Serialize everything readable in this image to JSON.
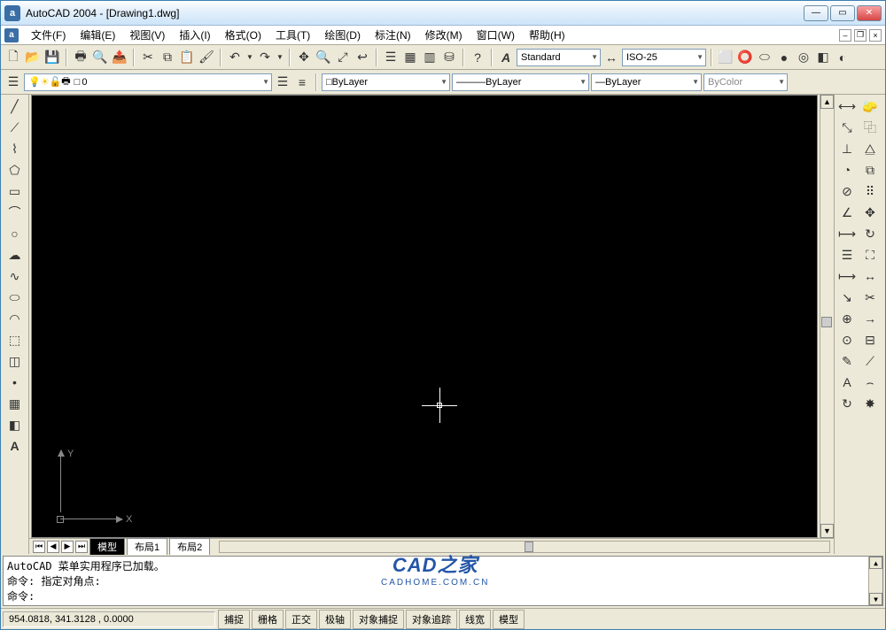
{
  "title": "AutoCAD 2004 - [Drawing1.dwg]",
  "app_icon": "a",
  "menu": [
    "文件(F)",
    "编辑(E)",
    "视图(V)",
    "插入(I)",
    "格式(O)",
    "工具(T)",
    "绘图(D)",
    "标注(N)",
    "修改(M)",
    "窗口(W)",
    "帮助(H)"
  ],
  "style_combo": "Standard",
  "dimstyle_combo": "ISO-25",
  "layer_combo": "0",
  "linetype1": "ByLayer",
  "linetype2": "ByLayer",
  "lineweight": "ByLayer",
  "plotstyle": "ByColor",
  "tabs": {
    "model": "模型",
    "layout1": "布局1",
    "layout2": "布局2"
  },
  "ucs": {
    "x": "X",
    "y": "Y"
  },
  "cmd1": "AutoCAD 菜单实用程序已加载。",
  "cmd2": "命令: 指定对角点:",
  "cmd_prompt": "命令:",
  "coords": "954.0818,  341.3128 ,  0.0000",
  "status_buttons": [
    "捕捉",
    "栅格",
    "正交",
    "极轴",
    "对象捕捉",
    "对象追踪",
    "线宽",
    "模型"
  ],
  "watermark": {
    "t1": "CAD之家",
    "t2": "CADHOME.COM.CN"
  }
}
